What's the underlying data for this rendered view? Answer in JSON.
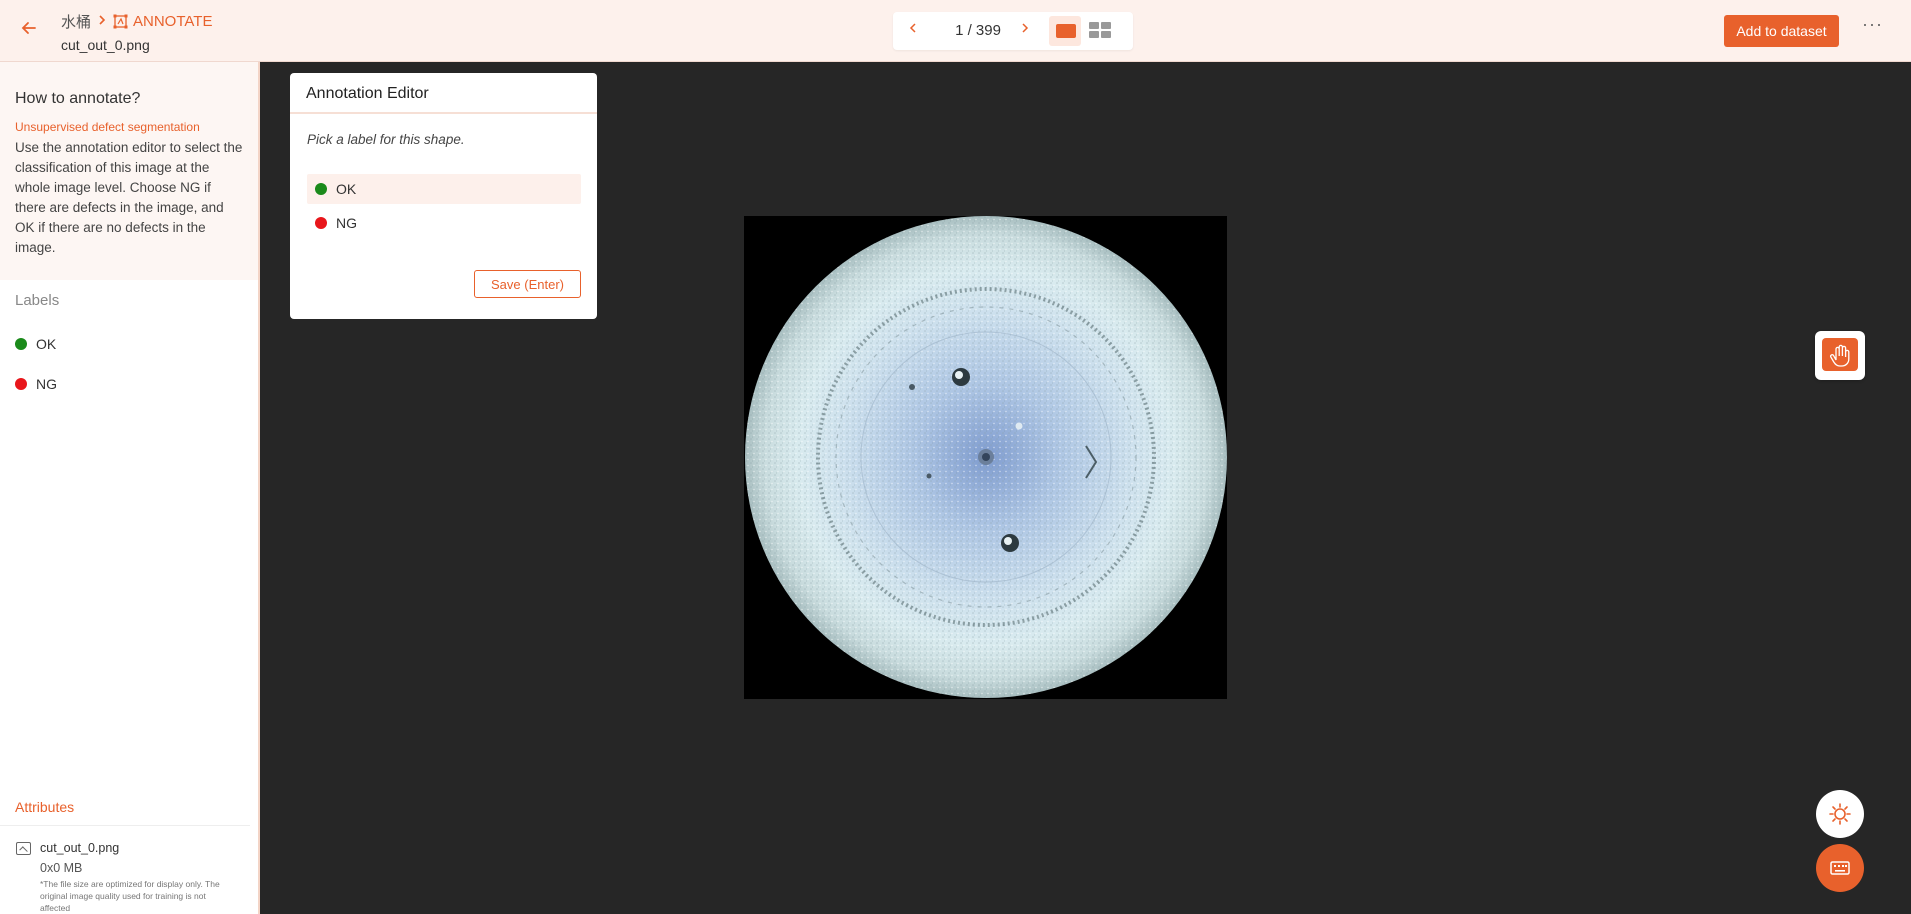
{
  "header": {
    "project": "水桶",
    "mode": "ANNOTATE",
    "filename": "cut_out_0.png",
    "pager": "1 / 399",
    "add_to_dataset": "Add to dataset"
  },
  "sidebar": {
    "howto_title": "How to annotate?",
    "howto_mode": "Unsupervised defect segmentation",
    "howto_text": "Use the annotation editor to select the classification of this image at the whole image level. Choose NG if there are defects in the image, and OK if there are no defects in the image.",
    "labels_title": "Labels",
    "labels": [
      {
        "name": "OK",
        "color": "#1a8a1a"
      },
      {
        "name": "NG",
        "color": "#e8161b"
      }
    ],
    "attributes_title": "Attributes",
    "attr_file": "cut_out_0.png",
    "attr_size": "0x0 MB",
    "attr_note": "*The file size are optimized for display only. The original image quality used for training is not affected"
  },
  "editor": {
    "title": "Annotation Editor",
    "prompt": "Pick a label for this shape.",
    "options": [
      {
        "name": "OK",
        "color": "#1a8a1a",
        "selected": true
      },
      {
        "name": "NG",
        "color": "#e8161b",
        "selected": false
      }
    ],
    "save": "Save (Enter)"
  },
  "colors": {
    "accent": "#e8612c",
    "canvas": "#262626"
  }
}
